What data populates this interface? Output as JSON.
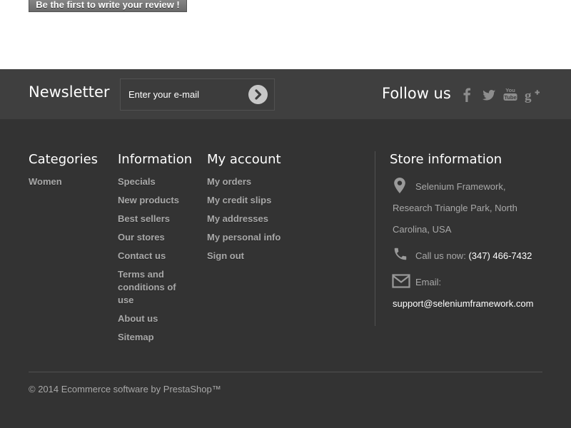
{
  "review": {
    "label": "Be the first to write your review !"
  },
  "newsletter": {
    "title": "Newsletter",
    "placeholder": "Enter your e-mail"
  },
  "follow": {
    "title": "Follow us",
    "icons": [
      "facebook-icon",
      "twitter-icon",
      "youtube-icon",
      "google-plus-icon"
    ]
  },
  "categories": {
    "title": "Categories",
    "items": [
      "Women"
    ]
  },
  "information": {
    "title": "Information",
    "items": [
      "Specials",
      "New products",
      "Best sellers",
      "Our stores",
      "Contact us",
      "Terms and conditions of use",
      "About us",
      "Sitemap"
    ]
  },
  "account": {
    "title": "My account",
    "items": [
      "My orders",
      "My credit slips",
      "My addresses",
      "My personal info",
      "Sign out"
    ]
  },
  "store": {
    "title": "Store information",
    "address": [
      "Selenium Framework,",
      "Research Triangle Park, North",
      "Carolina, USA"
    ],
    "call_label": "Call us now:",
    "phone": "(347) 466-7432",
    "email_label": "Email:",
    "email": "support@seleniumframework.com"
  },
  "footer": {
    "copyright": "© 2014 Ecommerce software by PrestaShop™"
  },
  "colors": {
    "footer_bg": "#333333",
    "newsletter_bg": "#3f3f3f",
    "link": "#a8a8a8"
  }
}
